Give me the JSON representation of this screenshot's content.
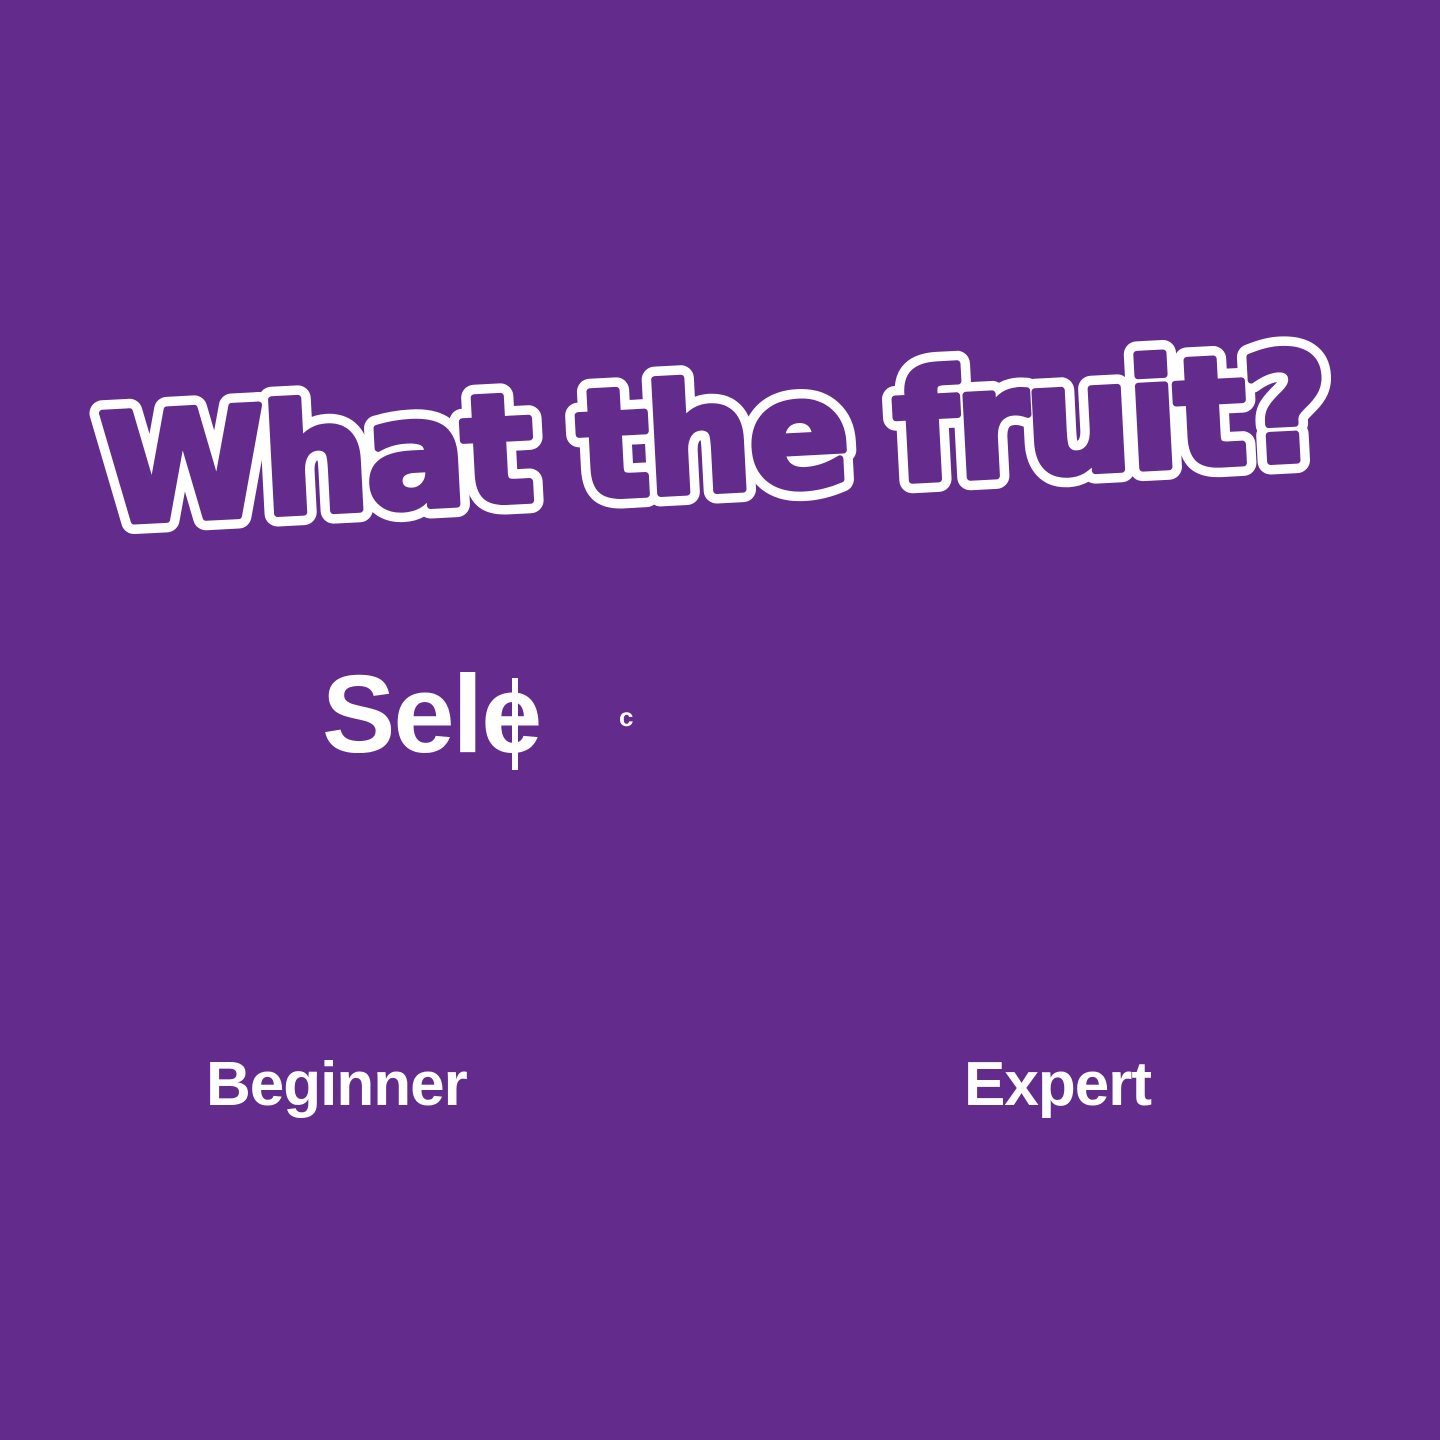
{
  "game": {
    "title": "What the fruit?",
    "select_prompt_visible": "Sele",
    "select_prompt_trailing": "c",
    "levels": [
      {
        "label": "Beginner"
      },
      {
        "label": "Expert"
      }
    ]
  },
  "colors": {
    "background": "#632C8C",
    "foreground": "#FFFFFF"
  }
}
